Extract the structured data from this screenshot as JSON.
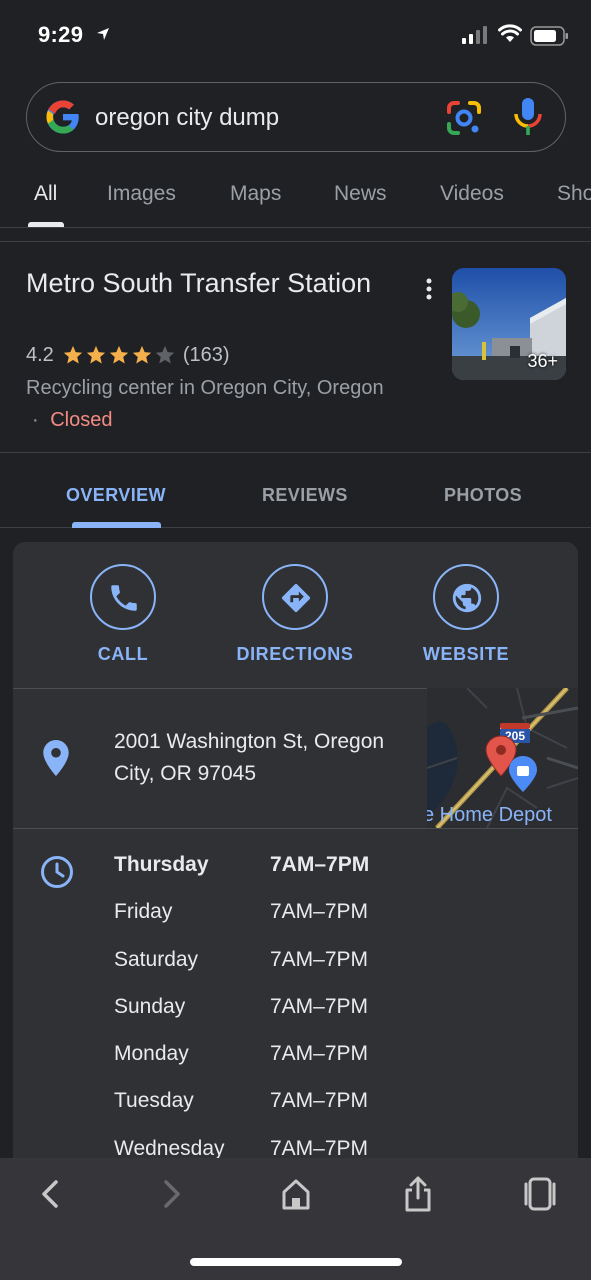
{
  "status_bar": {
    "time": "9:29"
  },
  "search": {
    "query": "oregon city dump"
  },
  "tabs": [
    {
      "label": "All",
      "active": true
    },
    {
      "label": "Images"
    },
    {
      "label": "Maps"
    },
    {
      "label": "News"
    },
    {
      "label": "Videos"
    },
    {
      "label": "Sho"
    }
  ],
  "place": {
    "title": "Metro South Transfer Station",
    "rating": "4.2",
    "stars_filled": 4.2,
    "review_count": "(163)",
    "category": "Recycling center in Oregon City, Oregon",
    "separator": "·",
    "status": "Closed",
    "photo_count": "36+"
  },
  "subtabs": [
    "OVERVIEW",
    "REVIEWS",
    "PHOTOS"
  ],
  "actions": [
    {
      "label": "CALL",
      "icon": "phone-icon"
    },
    {
      "label": "DIRECTIONS",
      "icon": "directions-icon"
    },
    {
      "label": "WEBSITE",
      "icon": "globe-icon"
    }
  ],
  "address": "2001 Washington St, Oregon City, OR 97045",
  "map": {
    "shield_label": "205",
    "poi_label": "e Home Depot"
  },
  "hours": [
    {
      "day": "Thursday",
      "time": "7AM–7PM",
      "today": true
    },
    {
      "day": "Friday",
      "time": "7AM–7PM"
    },
    {
      "day": "Saturday",
      "time": "7AM–7PM"
    },
    {
      "day": "Sunday",
      "time": "7AM–7PM"
    },
    {
      "day": "Monday",
      "time": "7AM–7PM"
    },
    {
      "day": "Tuesday",
      "time": "7AM–7PM"
    },
    {
      "day": "Wednesday",
      "time": "7AM–7PM"
    }
  ],
  "colors": {
    "background": "#202124",
    "card": "#303134",
    "accent_blue": "#8ab4f8",
    "closed_red": "#f28b82",
    "star_gold": "#f5b04c"
  }
}
